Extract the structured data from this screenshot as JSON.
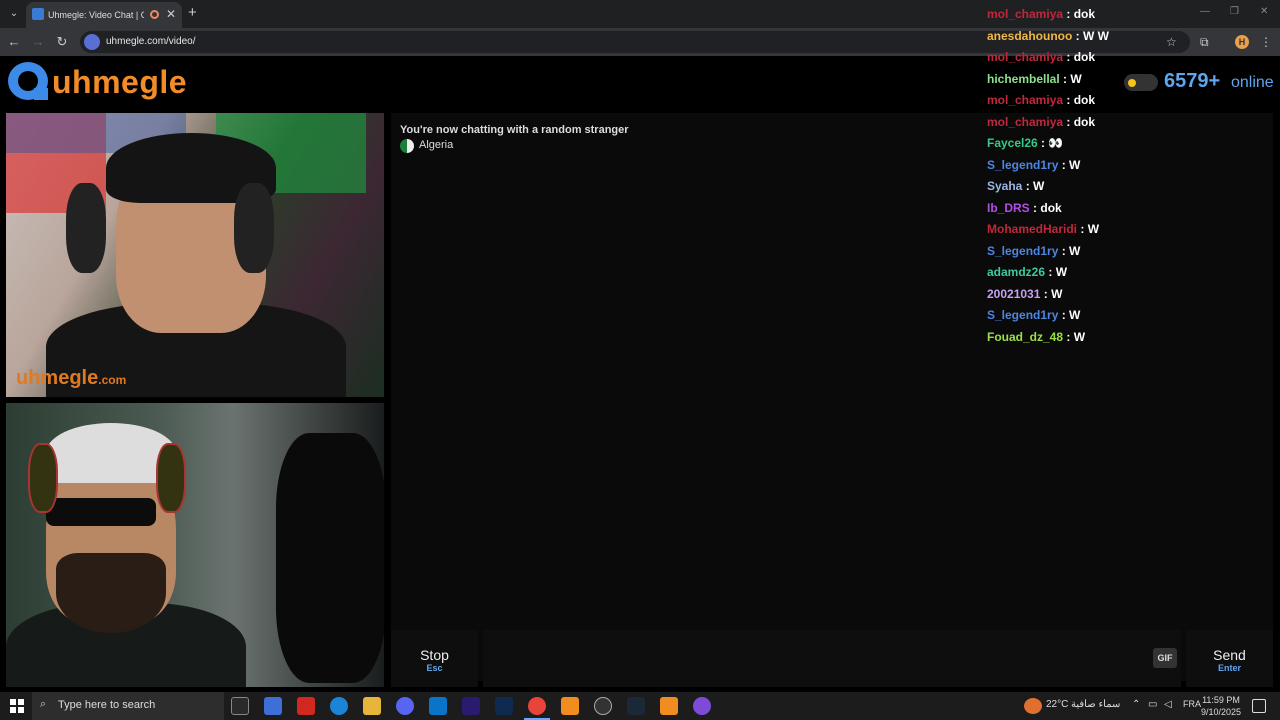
{
  "browser": {
    "tab_title": "Uhmegle: Video Chat | Om",
    "url": "uhmegle.com/video/"
  },
  "site": {
    "logo_text": "uhmegle",
    "online_count": "6579+",
    "online_label": "online"
  },
  "video": {
    "watermark": "uhmegle",
    "watermark_suffix": ".com"
  },
  "chat": {
    "status": "You're now chatting with a random stranger",
    "country": "Algeria",
    "stop_label": "Stop",
    "stop_shortcut": "Esc",
    "gif_label": "GIF",
    "send_label": "Send",
    "send_shortcut": "Enter"
  },
  "feed": [
    {
      "user": "mol_chamiya",
      "msg": "dok",
      "color": "#c0283c"
    },
    {
      "user": "anesdahounoo",
      "msg": "W W",
      "color": "#f0b845"
    },
    {
      "user": "mol_chamiya",
      "msg": "dok",
      "color": "#c0283c"
    },
    {
      "user": "hichembellal",
      "msg": "W",
      "color": "#8ee08a"
    },
    {
      "user": "mol_chamiya",
      "msg": "dok",
      "color": "#c0283c"
    },
    {
      "user": "mol_chamiya",
      "msg": "dok",
      "color": "#c0283c"
    },
    {
      "user": "Faycel26",
      "msg": "👀",
      "color": "#35c98a"
    },
    {
      "user": "S_legend1ry",
      "msg": "W",
      "color": "#4d86e0"
    },
    {
      "user": "Syaha",
      "msg": "W",
      "color": "#9ab7e8"
    },
    {
      "user": "Ib_DRS",
      "msg": "dok",
      "color": "#b14ee8"
    },
    {
      "user": "MohamedHaridi",
      "msg": "W",
      "color": "#c0283c"
    },
    {
      "user": "S_legend1ry",
      "msg": "W",
      "color": "#4d86e0"
    },
    {
      "user": "adamdz26",
      "msg": "W",
      "color": "#3fc9a0"
    },
    {
      "user": "20021031",
      "msg": "W",
      "color": "#c7a0f0"
    },
    {
      "user": "S_legend1ry",
      "msg": "W",
      "color": "#4d86e0"
    },
    {
      "user": "Fouad_dz_48",
      "msg": "W",
      "color": "#9be046"
    }
  ],
  "taskbar": {
    "search_placeholder": "Type here to search",
    "temperature": "22°C",
    "weather": "سماء صافية",
    "language": "FRA",
    "time": "11:59 PM",
    "date": "9/10/2025"
  }
}
